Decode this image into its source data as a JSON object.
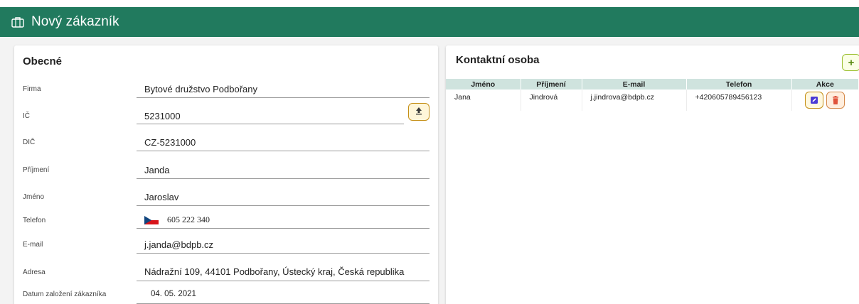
{
  "header": {
    "title": "Nový zákazník",
    "icon": "briefcase-icon"
  },
  "general": {
    "title": "Obecné",
    "fields": [
      {
        "label": "Firma",
        "value": "Bytové družstvo Podbořany"
      },
      {
        "label": "IČ",
        "value": "5231000"
      },
      {
        "label": "DIČ",
        "value": "CZ-5231000"
      },
      {
        "label": "Příjmení",
        "value": "Janda"
      },
      {
        "label": "Jméno",
        "value": "Jaroslav"
      },
      {
        "label": "Telefon",
        "value": "605 222 340"
      },
      {
        "label": "E-mail",
        "value": "j.janda@bdpb.cz"
      },
      {
        "label": "Adresa",
        "value": "Nádražní 109, 44101 Podbořany, Ústecký kraj, Česká republika"
      },
      {
        "label": "Datum založení zákazníka",
        "value": "04. 05. 2021"
      }
    ]
  },
  "contacts": {
    "title": "Kontaktní osoba",
    "add_label": "+",
    "columns": [
      "Jméno",
      "Příjmení",
      "E-mail",
      "Telefon",
      "Akce"
    ],
    "rows": [
      {
        "first_name": "Jana",
        "last_name": "Jindrová",
        "email": "j.jindrova@bdpb.cz",
        "phone": "+420605789456123"
      }
    ]
  },
  "colors": {
    "header": "#217a5e",
    "table_header": "#cfe3de",
    "edit_icon": "#4a3ad6",
    "delete_icon": "#e0533b"
  }
}
